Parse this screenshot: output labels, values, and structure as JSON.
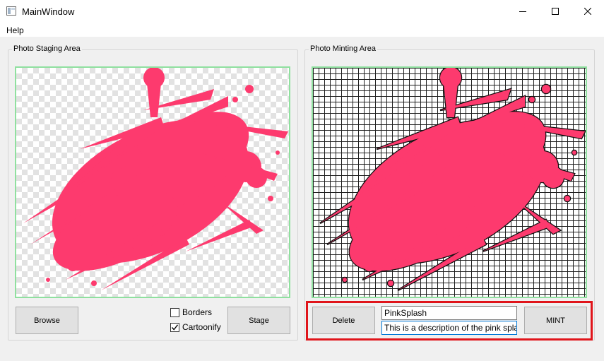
{
  "window": {
    "title": "MainWindow",
    "icon": "app-window-icon",
    "controls": {
      "minimize": "minimize-icon",
      "maximize": "maximize-icon",
      "close": "close-icon"
    }
  },
  "menu": {
    "items": [
      {
        "label": "Help"
      }
    ]
  },
  "staging": {
    "group_title": "Photo Staging Area",
    "browse_label": "Browse",
    "stage_label": "Stage",
    "options": [
      {
        "label": "Borders",
        "checked": false
      },
      {
        "label": "Cartoonify",
        "checked": true
      }
    ]
  },
  "minting": {
    "group_title": "Photo Minting Area",
    "delete_label": "Delete",
    "mint_label": "MINT",
    "name_value": "PinkSplash",
    "description_value": "This is a description of the pink splash"
  },
  "colors": {
    "splash": "#fd3a6e",
    "frame_border": "#8fe09f",
    "highlight": "#e0151b",
    "focus": "#0078d7"
  }
}
